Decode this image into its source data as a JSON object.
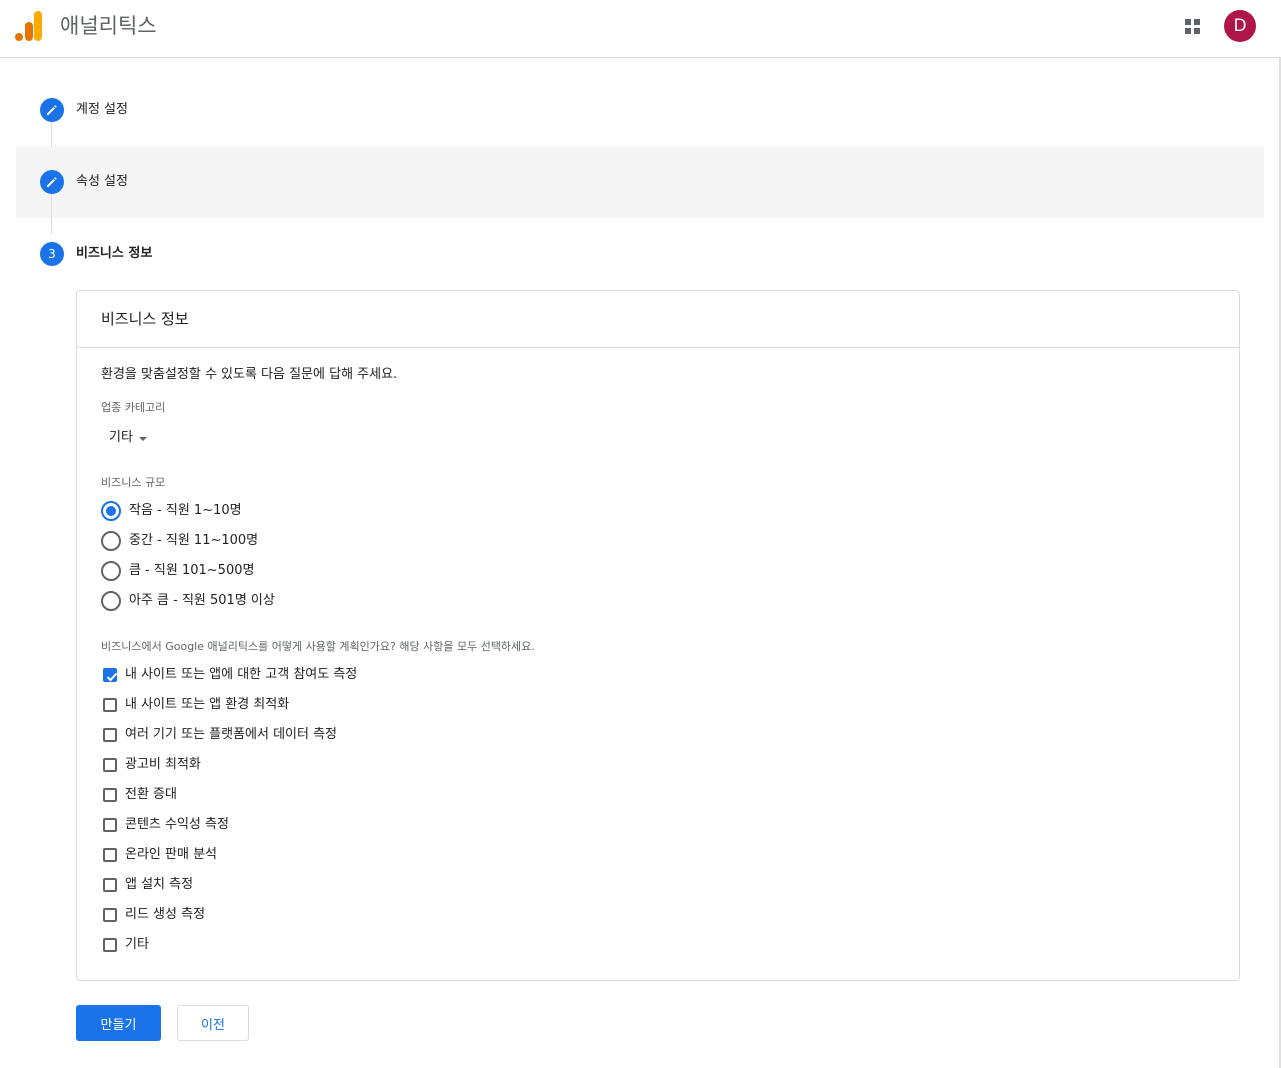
{
  "header": {
    "app_title": "애널리틱스",
    "avatar_initial": "D",
    "logo_icon": "google-analytics-logo",
    "apps_icon": "apps-grid-icon"
  },
  "colors": {
    "accent": "#1a73e8",
    "avatar": "#b0154a",
    "logo_orange": "#f9ab00",
    "logo_dark_orange": "#e37400"
  },
  "steps": [
    {
      "label": "계정 설정",
      "state": "edit",
      "icon": "pencil-icon"
    },
    {
      "label": "속성 설정",
      "state": "edit",
      "icon": "pencil-icon"
    },
    {
      "label": "비즈니스 정보",
      "state": "current",
      "number": "3"
    }
  ],
  "card": {
    "title": "비즈니스 정보",
    "intro": "환경을 맞춤설정할 수 있도록 다음 질문에 답해 주세요.",
    "industry": {
      "label": "업종 카테고리",
      "selected": "기타"
    },
    "size": {
      "label": "비즈니스 규모",
      "options": [
        {
          "text": "작음 - 직원 1~10명",
          "checked": true
        },
        {
          "text": "중간 - 직원 11~100명",
          "checked": false
        },
        {
          "text": "큼 - 직원 101~500명",
          "checked": false
        },
        {
          "text": "아주 큼 - 직원 501명 이상",
          "checked": false
        }
      ]
    },
    "usage": {
      "label": "비즈니스에서 Google 애널리틱스를 어떻게 사용할 계획인가요? 해당 사항을 모두 선택하세요.",
      "options": [
        {
          "text": "내 사이트 또는 앱에 대한 고객 참여도 측정",
          "checked": true
        },
        {
          "text": "내 사이트 또는 앱 환경 최적화",
          "checked": false
        },
        {
          "text": "여러 기기 또는 플랫폼에서 데이터 측정",
          "checked": false
        },
        {
          "text": "광고비 최적화",
          "checked": false
        },
        {
          "text": "전환 증대",
          "checked": false
        },
        {
          "text": "콘텐츠 수익성 측정",
          "checked": false
        },
        {
          "text": "온라인 판매 분석",
          "checked": false
        },
        {
          "text": "앱 설치 측정",
          "checked": false
        },
        {
          "text": "리드 생성 측정",
          "checked": false
        },
        {
          "text": "기타",
          "checked": false
        }
      ]
    }
  },
  "actions": {
    "create_label": "만들기",
    "back_label": "이전"
  }
}
